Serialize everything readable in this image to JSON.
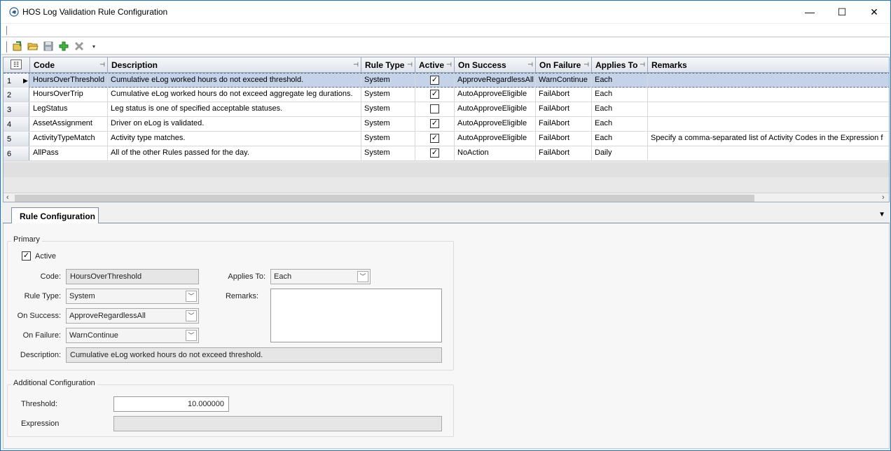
{
  "window": {
    "title": "HOS Log Validation Rule Configuration",
    "minimize_glyph": "—",
    "maximize_glyph": "☐",
    "close_glyph": "✕"
  },
  "toolbar": {
    "icons": [
      "new-icon",
      "open-folder-icon",
      "save-icon",
      "add-icon",
      "delete-icon",
      "dropdown-arrow-icon"
    ]
  },
  "grid": {
    "columns": [
      {
        "label": "Code",
        "pinned": true
      },
      {
        "label": "Description",
        "pinned": true
      },
      {
        "label": "Rule Type",
        "pinned": true
      },
      {
        "label": "Active",
        "pinned": true
      },
      {
        "label": "On Success",
        "pinned": true
      },
      {
        "label": "On Failure",
        "pinned": true
      },
      {
        "label": "Applies To",
        "pinned": true
      },
      {
        "label": "Remarks",
        "pinned": false
      }
    ],
    "rows": [
      {
        "num": "1",
        "code": "HoursOverThreshold",
        "description": "Cumulative eLog worked hours do not exceed threshold.",
        "rule_type": "System",
        "active": true,
        "on_success": "ApproveRegardlessAll",
        "on_failure": "WarnContinue",
        "applies_to": "Each",
        "remarks": ""
      },
      {
        "num": "2",
        "code": "HoursOverTrip",
        "description": "Cumulative eLog worked hours do not exceed aggregate leg durations.",
        "rule_type": "System",
        "active": true,
        "on_success": "AutoApproveEligible",
        "on_failure": "FailAbort",
        "applies_to": "Each",
        "remarks": ""
      },
      {
        "num": "3",
        "code": "LegStatus",
        "description": "Leg status is one of specified acceptable statuses.",
        "rule_type": "System",
        "active": false,
        "on_success": "AutoApproveEligible",
        "on_failure": "FailAbort",
        "applies_to": "Each",
        "remarks": ""
      },
      {
        "num": "4",
        "code": "AssetAssignment",
        "description": "Driver on eLog is validated.",
        "rule_type": "System",
        "active": true,
        "on_success": "AutoApproveEligible",
        "on_failure": "FailAbort",
        "applies_to": "Each",
        "remarks": ""
      },
      {
        "num": "5",
        "code": "ActivityTypeMatch",
        "description": "Activity type matches.",
        "rule_type": "System",
        "active": true,
        "on_success": "AutoApproveEligible",
        "on_failure": "FailAbort",
        "applies_to": "Each",
        "remarks": "Specify a comma-separated list of Activity Codes in the Expression f"
      },
      {
        "num": "6",
        "code": "AllPass",
        "description": "All of the other Rules passed for the day.",
        "rule_type": "System",
        "active": true,
        "on_success": "NoAction",
        "on_failure": "FailAbort",
        "applies_to": "Daily",
        "remarks": ""
      }
    ],
    "selected_row": 0
  },
  "tab": {
    "label": "Rule Configuration"
  },
  "form": {
    "primary_title": "Primary",
    "active_label": "Active",
    "active_checked": true,
    "code_label": "Code:",
    "code_value": "HoursOverThreshold",
    "rule_type_label": "Rule Type:",
    "rule_type_value": "System",
    "on_success_label": "On Success:",
    "on_success_value": "ApproveRegardlessAll",
    "on_failure_label": "On Failure:",
    "on_failure_value": "WarnContinue",
    "description_label": "Description:",
    "description_value": "Cumulative eLog worked hours do not exceed threshold.",
    "applies_to_label": "Applies To:",
    "applies_to_value": "Each",
    "remarks_label": "Remarks:",
    "remarks_value": "",
    "additional_title": "Additional Configuration",
    "threshold_label": "Threshold:",
    "threshold_value": "10.000000",
    "expression_label": "Expression",
    "expression_value": ""
  },
  "colors": {
    "selected_row": "#c5d3e8",
    "window_border": "#1a73c8"
  }
}
